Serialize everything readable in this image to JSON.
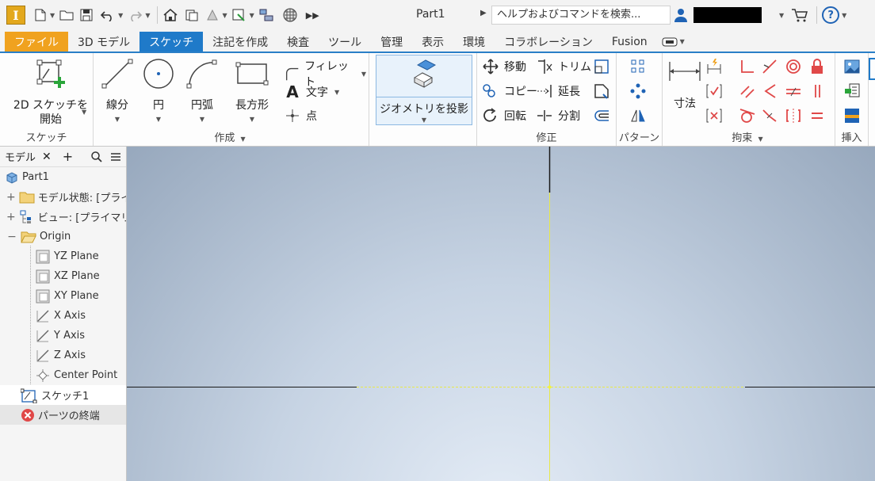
{
  "app": {
    "logo_letter": "I",
    "document_title": "Part1",
    "search_placeholder": "ヘルプおよびコマンドを検索...",
    "help_icon_text": "?"
  },
  "tabs": [
    {
      "label": "ファイル"
    },
    {
      "label": "3D モデル"
    },
    {
      "label": "スケッチ",
      "active": true
    },
    {
      "label": "注記を作成"
    },
    {
      "label": "検査"
    },
    {
      "label": "ツール"
    },
    {
      "label": "管理"
    },
    {
      "label": "表示"
    },
    {
      "label": "環境"
    },
    {
      "label": "コラボレーション"
    },
    {
      "label": "Fusion"
    }
  ],
  "ribbon": {
    "sketch_panel": {
      "title": "スケッチ",
      "start_sketch_line1": "2D スケッチを",
      "start_sketch_line2": "開始"
    },
    "create_panel": {
      "title": "作成",
      "line": "線分",
      "circle": "円",
      "arc": "円弧",
      "rectangle": "長方形",
      "fillet": "フィレット",
      "text": "文字",
      "point": "点"
    },
    "project_panel": {
      "project_geometry": "ジオメトリを投影"
    },
    "modify_panel": {
      "title": "修正",
      "move": "移動",
      "copy": "コピー",
      "rotate": "回転",
      "trim": "トリム",
      "extend": "延長",
      "split": "分割"
    },
    "pattern_panel": {
      "title": "パターン"
    },
    "constrain_panel": {
      "title": "拘束",
      "dimension": "寸法"
    },
    "insert_panel": {
      "title": "挿入"
    }
  },
  "browser": {
    "tab_label": "モデル",
    "tree": [
      {
        "label": "Part1",
        "indent": 0,
        "icon": "part-icon"
      },
      {
        "label": "モデル状態: [プライ",
        "indent": 1,
        "icon": "folder-icon",
        "expander": "+"
      },
      {
        "label": "ビュー: [プライマリ]",
        "indent": 1,
        "icon": "view-icon",
        "expander": "+"
      },
      {
        "label": "Origin",
        "indent": 1,
        "icon": "folder-open-icon",
        "expander": "−"
      },
      {
        "label": "YZ Plane",
        "indent": 2,
        "icon": "plane-icon"
      },
      {
        "label": "XZ Plane",
        "indent": 2,
        "icon": "plane-icon"
      },
      {
        "label": "XY Plane",
        "indent": 2,
        "icon": "plane-icon"
      },
      {
        "label": "X Axis",
        "indent": 2,
        "icon": "axis-icon"
      },
      {
        "label": "Y Axis",
        "indent": 2,
        "icon": "axis-icon"
      },
      {
        "label": "Z Axis",
        "indent": 2,
        "icon": "axis-icon"
      },
      {
        "label": "Center Point",
        "indent": 2,
        "icon": "center-point-icon"
      },
      {
        "label": "スケッチ1",
        "indent": 1,
        "icon": "sketch-icon",
        "selected": true
      },
      {
        "label": "パーツの終端",
        "indent": 1,
        "icon": "end-of-part-icon",
        "dim": true
      }
    ]
  },
  "colors": {
    "file_tab": "#f0a21f",
    "active_tab": "#1f7ac9",
    "sketch_axis": "#e8e84a",
    "error_red": "#e04848"
  }
}
